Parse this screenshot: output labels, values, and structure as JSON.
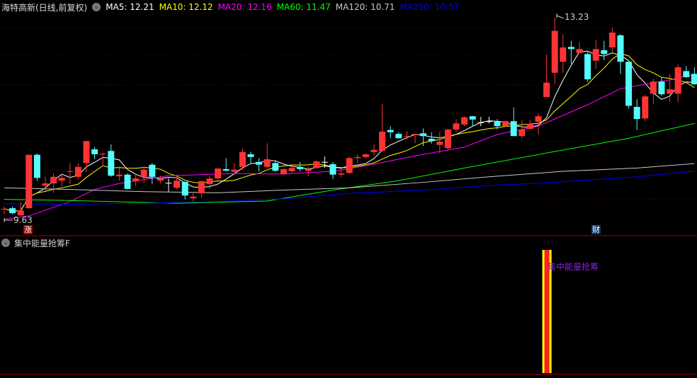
{
  "header": {
    "title": "海特高新(日线,前复权)",
    "ma_labels": [
      {
        "text": "MA5: 12.21",
        "color": "#ffffff"
      },
      {
        "text": "MA10: 12.12",
        "color": "#ffff00"
      },
      {
        "text": "MA20: 12.16",
        "color": "#ff00ff"
      },
      {
        "text": "MA60: 11.47",
        "color": "#00ff00"
      },
      {
        "text": "MA120: 10.71",
        "color": "#c8c8c8"
      },
      {
        "text": "MA250: 10.57",
        "color": "#0000ff"
      }
    ]
  },
  "markers": {
    "zhang": "涨",
    "cai": "财"
  },
  "indicator": {
    "title": "集中能量抢筹F",
    "signal_label": "集中能量抢筹",
    "signal_candle": 67
  },
  "chart_data": {
    "type": "candlestick",
    "high_label": "13.23",
    "low_label": "9.63",
    "colors": {
      "up": "#ff3333",
      "down": "#54fcfc",
      "flat": "#ffffff"
    },
    "candles": [
      [
        9.75,
        9.8,
        9.66,
        9.76
      ],
      [
        9.77,
        9.8,
        9.66,
        9.68
      ],
      [
        9.64,
        9.89,
        9.63,
        9.73
      ],
      [
        9.77,
        10.74,
        9.76,
        10.74
      ],
      [
        10.74,
        10.76,
        10.27,
        10.32
      ],
      [
        10.18,
        10.34,
        10.08,
        10.22
      ],
      [
        10.22,
        10.4,
        10.05,
        10.34
      ],
      [
        10.27,
        10.39,
        10.16,
        10.32
      ],
      [
        10.43,
        10.59,
        10.21,
        10.44
      ],
      [
        10.34,
        10.59,
        10.29,
        10.52
      ],
      [
        10.59,
        10.99,
        10.43,
        10.99
      ],
      [
        10.84,
        10.88,
        10.66,
        10.75
      ],
      [
        10.75,
        10.78,
        10.53,
        10.76
      ],
      [
        10.81,
        10.93,
        10.34,
        10.36
      ],
      [
        10.35,
        10.53,
        10.27,
        10.38
      ],
      [
        10.38,
        10.4,
        10.11,
        10.12
      ],
      [
        10.26,
        10.4,
        10.17,
        10.31
      ],
      [
        10.34,
        10.53,
        10.23,
        10.47
      ],
      [
        10.56,
        10.59,
        10.21,
        10.34
      ],
      [
        10.27,
        10.36,
        10.22,
        10.3
      ],
      [
        10.23,
        10.31,
        10.07,
        10.23
      ],
      [
        10.14,
        10.36,
        10.11,
        10.27
      ],
      [
        10.25,
        10.25,
        9.93,
        10.0
      ],
      [
        9.95,
        10.05,
        9.89,
        9.98
      ],
      [
        10.04,
        10.27,
        9.96,
        10.26
      ],
      [
        10.21,
        10.36,
        10.12,
        10.31
      ],
      [
        10.31,
        10.5,
        10.29,
        10.49
      ],
      [
        10.48,
        10.68,
        10.44,
        10.45
      ],
      [
        10.43,
        10.59,
        10.42,
        10.47
      ],
      [
        10.52,
        10.85,
        10.47,
        10.79
      ],
      [
        10.75,
        10.79,
        10.59,
        10.7
      ],
      [
        10.61,
        10.68,
        10.44,
        10.56
      ],
      [
        10.52,
        10.95,
        10.49,
        10.66
      ],
      [
        10.59,
        10.62,
        10.43,
        10.45
      ],
      [
        10.39,
        10.49,
        10.38,
        10.48
      ],
      [
        10.44,
        10.54,
        10.41,
        10.5
      ],
      [
        10.52,
        10.61,
        10.44,
        10.48
      ],
      [
        10.45,
        10.52,
        10.35,
        10.48
      ],
      [
        10.5,
        10.64,
        10.49,
        10.62
      ],
      [
        10.61,
        10.71,
        10.5,
        10.61
      ],
      [
        10.57,
        10.61,
        10.3,
        10.38
      ],
      [
        10.38,
        10.49,
        10.34,
        10.4
      ],
      [
        10.41,
        10.71,
        10.4,
        10.68
      ],
      [
        10.68,
        10.75,
        10.59,
        10.7
      ],
      [
        10.7,
        10.76,
        10.67,
        10.75
      ],
      [
        10.79,
        10.93,
        10.73,
        10.83
      ],
      [
        10.81,
        11.66,
        10.8,
        11.16
      ],
      [
        11.19,
        11.26,
        11.04,
        11.15
      ],
      [
        11.12,
        11.15,
        11.04,
        11.04
      ],
      [
        11.07,
        11.17,
        11.02,
        11.08
      ],
      [
        11.1,
        11.12,
        10.95,
        11.12
      ],
      [
        11.13,
        11.22,
        10.9,
        11.08
      ],
      [
        11.03,
        11.15,
        10.94,
        10.99
      ],
      [
        10.92,
        11.16,
        10.77,
        10.98
      ],
      [
        10.86,
        11.21,
        10.83,
        11.2
      ],
      [
        11.2,
        11.39,
        11.15,
        11.31
      ],
      [
        11.29,
        11.44,
        11.26,
        11.42
      ],
      [
        11.44,
        11.45,
        11.25,
        11.38
      ],
      [
        11.33,
        11.43,
        11.26,
        11.33
      ],
      [
        11.35,
        11.43,
        11.31,
        11.35
      ],
      [
        11.34,
        11.39,
        11.2,
        11.26
      ],
      [
        11.26,
        11.36,
        11.25,
        11.35
      ],
      [
        11.35,
        11.6,
        11.08,
        11.08
      ],
      [
        11.08,
        11.37,
        11.04,
        11.2
      ],
      [
        11.21,
        11.37,
        11.2,
        11.3
      ],
      [
        11.34,
        11.49,
        11.11,
        11.44
      ],
      [
        11.79,
        12.56,
        11.79,
        12.05
      ],
      [
        12.23,
        13.23,
        12.03,
        12.99
      ],
      [
        12.43,
        12.93,
        12.23,
        12.69
      ],
      [
        12.7,
        12.81,
        12.39,
        12.66
      ],
      [
        12.59,
        12.79,
        12.59,
        12.66
      ],
      [
        12.57,
        12.6,
        12.07,
        12.11
      ],
      [
        12.45,
        12.82,
        12.3,
        12.66
      ],
      [
        12.64,
        12.81,
        12.46,
        12.57
      ],
      [
        12.69,
        13.05,
        12.61,
        12.96
      ],
      [
        12.91,
        12.93,
        12.21,
        12.43
      ],
      [
        12.43,
        12.43,
        11.58,
        11.63
      ],
      [
        11.61,
        11.75,
        11.19,
        11.39
      ],
      [
        11.4,
        11.83,
        11.35,
        11.8
      ],
      [
        11.85,
        12.12,
        11.66,
        12.07
      ],
      [
        12.07,
        12.15,
        11.81,
        11.84
      ],
      [
        11.85,
        12.21,
        11.7,
        11.93
      ],
      [
        11.85,
        12.38,
        11.7,
        12.33
      ],
      [
        12.26,
        12.35,
        12.14,
        12.15
      ],
      [
        12.21,
        12.33,
        12.01,
        12.02
      ]
    ],
    "moving_averages": [
      {
        "name": "MA5",
        "color": "#ffffff",
        "period": 5
      },
      {
        "name": "MA10",
        "color": "#ffff00",
        "period": 10
      },
      {
        "name": "MA20",
        "color": "#ff00ff",
        "points": [
          [
            1,
            9.57
          ],
          [
            4,
            9.63
          ],
          [
            9,
            9.89
          ],
          [
            12,
            10.11
          ],
          [
            15,
            10.22
          ],
          [
            21,
            10.36
          ],
          [
            29,
            10.4
          ],
          [
            35,
            10.39
          ],
          [
            41,
            10.44
          ],
          [
            45,
            10.54
          ],
          [
            51,
            10.72
          ],
          [
            57,
            10.88
          ],
          [
            61,
            11.11
          ],
          [
            66,
            11.26
          ],
          [
            72,
            11.65
          ],
          [
            76,
            11.94
          ],
          [
            82,
            12.1
          ],
          [
            85,
            12.2
          ]
        ]
      },
      {
        "name": "MA60",
        "color": "#00ff00",
        "points": [
          [
            1,
            9.93
          ],
          [
            9,
            9.91
          ],
          [
            22,
            9.86
          ],
          [
            33,
            9.9
          ],
          [
            41,
            10.1
          ],
          [
            49,
            10.27
          ],
          [
            57,
            10.5
          ],
          [
            68,
            10.8
          ],
          [
            77,
            11.04
          ],
          [
            85,
            11.31
          ]
        ]
      },
      {
        "name": "MA120",
        "color": "#c8c8c8",
        "points": [
          [
            1,
            10.14
          ],
          [
            9,
            10.11
          ],
          [
            18,
            10.07
          ],
          [
            27,
            10.05
          ],
          [
            35,
            10.1
          ],
          [
            43,
            10.14
          ],
          [
            52,
            10.24
          ],
          [
            60,
            10.34
          ],
          [
            69,
            10.44
          ],
          [
            78,
            10.5
          ],
          [
            85,
            10.58
          ]
        ]
      },
      {
        "name": "MA250",
        "color": "#0000ff",
        "points": [
          [
            1,
            9.85
          ],
          [
            9,
            9.84
          ],
          [
            18,
            9.86
          ],
          [
            27,
            9.89
          ],
          [
            35,
            9.94
          ],
          [
            43,
            10.04
          ],
          [
            52,
            10.1
          ],
          [
            60,
            10.18
          ],
          [
            69,
            10.25
          ],
          [
            78,
            10.34
          ],
          [
            85,
            10.44
          ]
        ]
      }
    ]
  }
}
